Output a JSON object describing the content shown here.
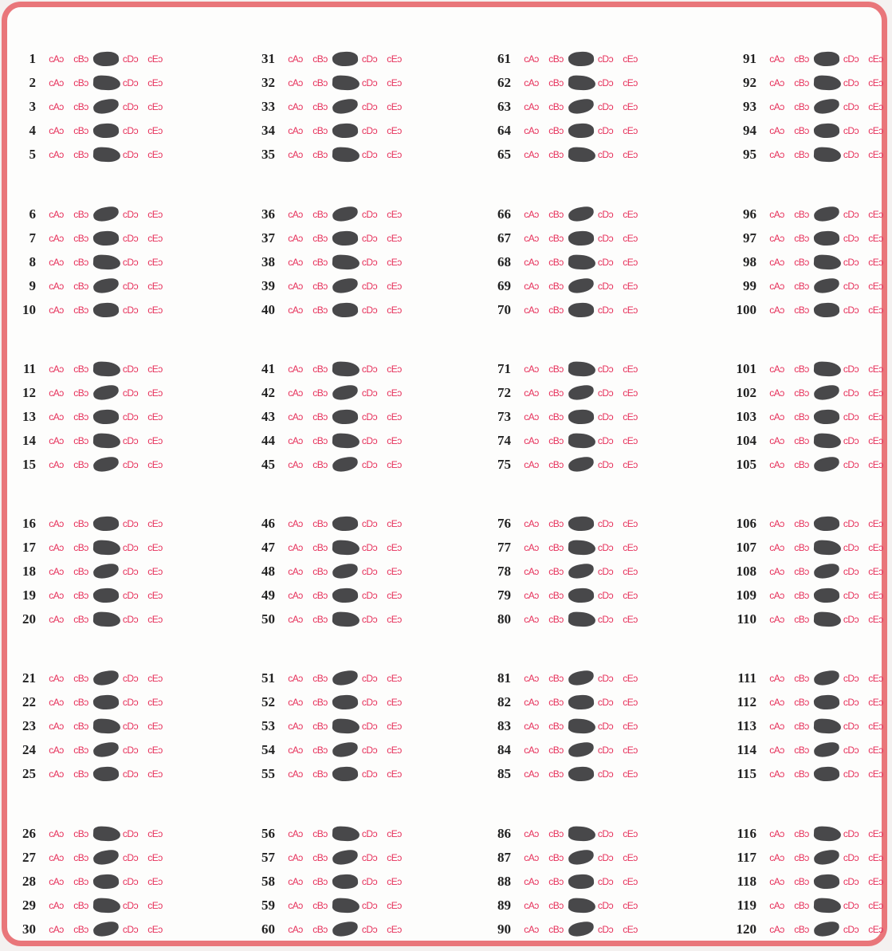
{
  "question_numbers": [
    "1",
    "2",
    "3",
    "4",
    "5",
    "6",
    "7",
    "8",
    "9",
    "10",
    "11",
    "12",
    "13",
    "14",
    "15",
    "16",
    "17",
    "18",
    "19",
    "20",
    "21",
    "22",
    "23",
    "24",
    "25",
    "26",
    "27",
    "28",
    "29",
    "30",
    "31",
    "32",
    "33",
    "34",
    "35",
    "36",
    "37",
    "38",
    "39",
    "40",
    "41",
    "42",
    "43",
    "44",
    "45",
    "46",
    "47",
    "48",
    "49",
    "50",
    "51",
    "52",
    "53",
    "54",
    "55",
    "56",
    "57",
    "58",
    "59",
    "60",
    "61",
    "62",
    "63",
    "64",
    "65",
    "66",
    "67",
    "68",
    "69",
    "70",
    "71",
    "72",
    "73",
    "74",
    "75",
    "76",
    "77",
    "78",
    "79",
    "80",
    "81",
    "82",
    "83",
    "84",
    "85",
    "86",
    "87",
    "88",
    "89",
    "90",
    "91",
    "92",
    "93",
    "94",
    "95",
    "96",
    "97",
    "98",
    "99",
    "100",
    "101",
    "102",
    "103",
    "104",
    "105",
    "106",
    "107",
    "108",
    "109",
    "110",
    "111",
    "112",
    "113",
    "114",
    "115",
    "116",
    "117",
    "118",
    "119",
    "120"
  ],
  "option_labels": [
    "cAɔ",
    "cBɔ",
    "cCɔ",
    "cDɔ",
    "cEɔ"
  ],
  "marked_option": "C",
  "colors": {
    "border": "#e9767a",
    "bubble_text": "#e6305a",
    "pencil_mark": "#3e3e40",
    "number_text": "#222222"
  }
}
